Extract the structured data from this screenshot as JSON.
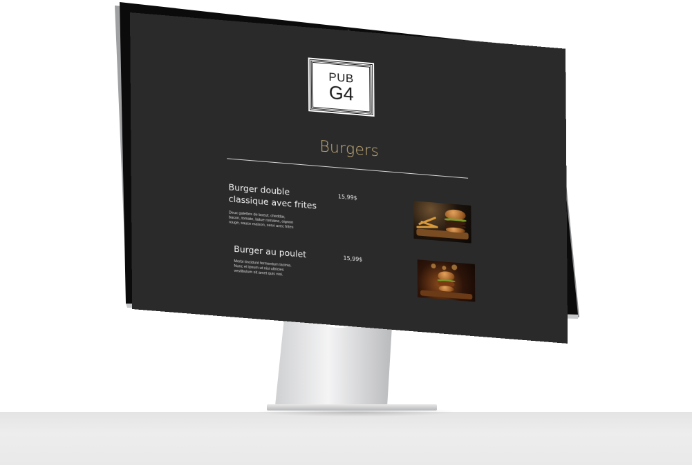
{
  "site": {
    "logo_line1": "PUB",
    "logo_line2": "G4"
  },
  "menu": {
    "category_title": "Burgers",
    "items": [
      {
        "name": "Burger double classique avec frites",
        "price": "15,99$",
        "description": "Deux galettes de boeuf, cheddar, bacon, tomate, laitue romaine, oignon rouge, sauce maison, servi avec frites",
        "image_alt": "burger-with-fries-photo"
      },
      {
        "name": "Burger au poulet",
        "price": "15,99$",
        "description": "Morbi tincidunt fermentum lacinia. Nunc et ipsum ut nisi ultricies vestibulum sit amet quis nisi.",
        "image_alt": "chicken-burger-photo"
      }
    ]
  },
  "colors": {
    "screen_background": "#2a2a2b",
    "accent_title": "#c9b27a",
    "text": "#f1f1f1"
  }
}
